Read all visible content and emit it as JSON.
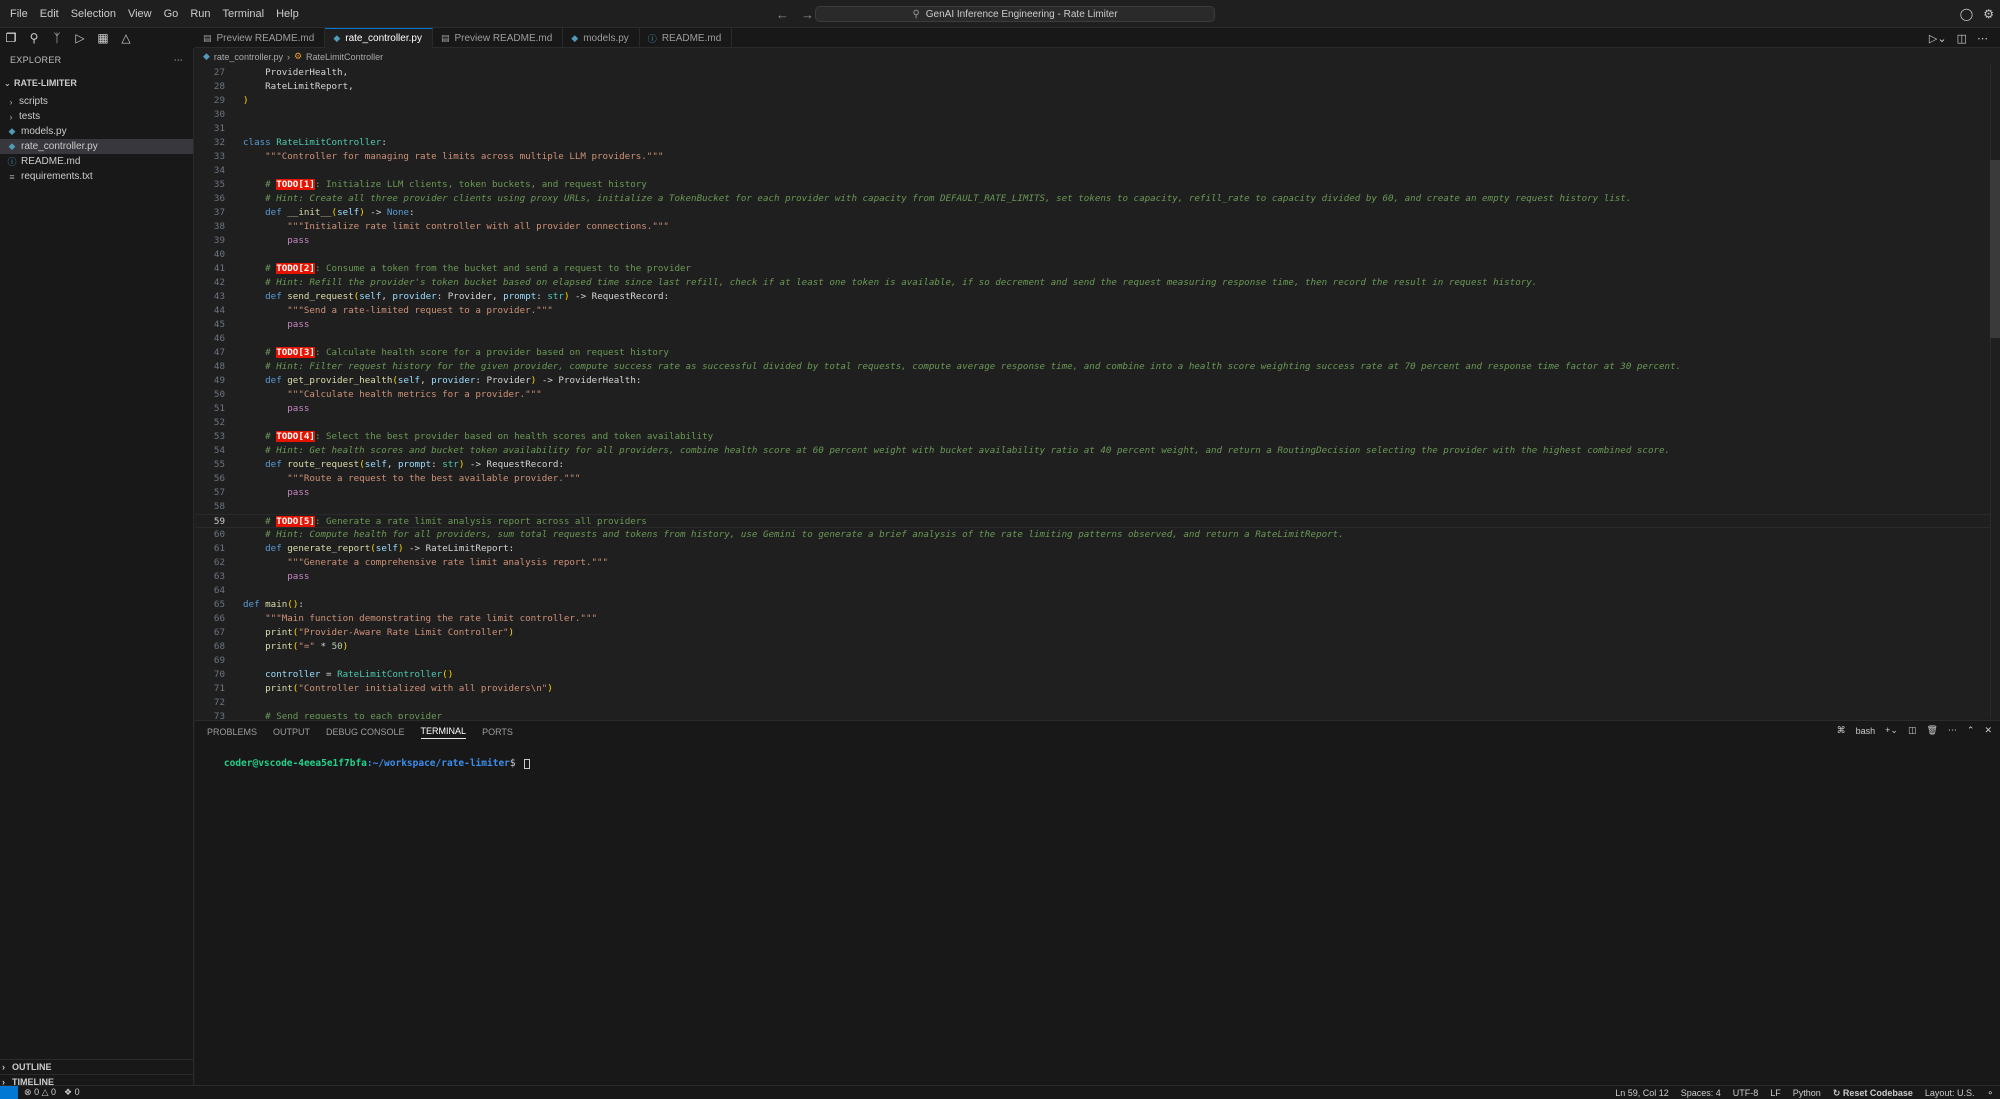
{
  "menu": [
    "File",
    "Edit",
    "Selection",
    "View",
    "Go",
    "Run",
    "Terminal",
    "Help"
  ],
  "command_center": "GenAI Inference Engineering - Rate Limiter",
  "tabs": [
    {
      "label": "Preview README.md",
      "icon": "preview-icon"
    },
    {
      "label": "rate_controller.py",
      "icon": "python-file-icon"
    },
    {
      "label": "Preview README.md",
      "icon": "preview-icon"
    },
    {
      "label": "models.py",
      "icon": "python-file-icon"
    },
    {
      "label": "README.md",
      "icon": "info-icon"
    }
  ],
  "explorer": {
    "title": "EXPLORER",
    "root": "RATE-LIMITER",
    "items": [
      {
        "label": "scripts",
        "type": "folder"
      },
      {
        "label": "tests",
        "type": "folder"
      },
      {
        "label": "models.py",
        "type": "py"
      },
      {
        "label": "rate_controller.py",
        "type": "py"
      },
      {
        "label": "README.md",
        "type": "md"
      },
      {
        "label": "requirements.txt",
        "type": "txt"
      }
    ],
    "outline": "OUTLINE",
    "timeline": "TIMELINE"
  },
  "breadcrumb": {
    "file": "rate_controller.py",
    "symbol": "RateLimitController"
  },
  "code": [
    {
      "n": "27",
      "t": [
        [
          "pl",
          "    ProviderHealth,"
        ]
      ]
    },
    {
      "n": "28",
      "t": [
        [
          "pl",
          "    RateLimitReport,"
        ]
      ]
    },
    {
      "n": "29",
      "t": [
        [
          "br",
          ")"
        ]
      ]
    },
    {
      "n": "30",
      "t": []
    },
    {
      "n": "31",
      "t": []
    },
    {
      "n": "32",
      "t": [
        [
          "kw",
          "class "
        ],
        [
          "cls",
          "RateLimitController"
        ],
        [
          "pl",
          ":"
        ]
      ]
    },
    {
      "n": "33",
      "t": [
        [
          "str",
          "    \"\"\"Controller for managing rate limits across multiple LLM providers.\"\"\""
        ]
      ]
    },
    {
      "n": "34",
      "t": []
    },
    {
      "n": "35",
      "t": [
        [
          "cm",
          "    # "
        ],
        [
          "todo",
          "TODO[1]"
        ],
        [
          "cm",
          ": Initialize LLM clients, token buckets, and request history"
        ]
      ]
    },
    {
      "n": "36",
      "t": [
        [
          "cmi",
          "    # Hint: Create all three provider clients using proxy URLs, initialize a TokenBucket for each provider with capacity from DEFAULT_RATE_LIMITS, set tokens to capacity, refill_rate to capacity divided by 60, and create an empty request history list."
        ]
      ]
    },
    {
      "n": "37",
      "t": [
        [
          "kw",
          "    def "
        ],
        [
          "fn",
          "__init__"
        ],
        [
          "br",
          "("
        ],
        [
          "pm",
          "self"
        ],
        [
          "br",
          ")"
        ],
        [
          "op",
          " -> "
        ],
        [
          "kw",
          "None"
        ],
        [
          "pl",
          ":"
        ]
      ]
    },
    {
      "n": "38",
      "t": [
        [
          "str",
          "        \"\"\"Initialize rate limit controller with all provider connections.\"\"\""
        ]
      ]
    },
    {
      "n": "39",
      "t": [
        [
          "kw2",
          "        pass"
        ]
      ]
    },
    {
      "n": "40",
      "t": []
    },
    {
      "n": "41",
      "t": [
        [
          "cm",
          "    # "
        ],
        [
          "todo",
          "TODO[2]"
        ],
        [
          "cm",
          ": Consume a token from the bucket and send a request to the provider"
        ]
      ]
    },
    {
      "n": "42",
      "t": [
        [
          "cmi",
          "    # Hint: Refill the provider's token bucket based on elapsed time since last refill, check if at least one token is available, if so decrement and send the request measuring response time, then record the result in request history."
        ]
      ]
    },
    {
      "n": "43",
      "t": [
        [
          "kw",
          "    def "
        ],
        [
          "fn",
          "send_request"
        ],
        [
          "br",
          "("
        ],
        [
          "pm",
          "self"
        ],
        [
          "pl",
          ", "
        ],
        [
          "pm",
          "provider"
        ],
        [
          "pl",
          ": Provider, "
        ],
        [
          "pm",
          "prompt"
        ],
        [
          "pl",
          ": "
        ],
        [
          "cls",
          "str"
        ],
        [
          "br",
          ")"
        ],
        [
          "op",
          " -> "
        ],
        [
          "pl",
          "RequestRecord:"
        ]
      ]
    },
    {
      "n": "44",
      "t": [
        [
          "str",
          "        \"\"\"Send a rate-limited request to a provider.\"\"\""
        ]
      ]
    },
    {
      "n": "45",
      "t": [
        [
          "kw2",
          "        pass"
        ]
      ]
    },
    {
      "n": "46",
      "t": []
    },
    {
      "n": "47",
      "t": [
        [
          "cm",
          "    # "
        ],
        [
          "todo",
          "TODO[3]"
        ],
        [
          "cm",
          ": Calculate health score for a provider based on request history"
        ]
      ]
    },
    {
      "n": "48",
      "t": [
        [
          "cmi",
          "    # Hint: Filter request history for the given provider, compute success rate as successful divided by total requests, compute average response time, and combine into a health score weighting success rate at 70 percent and response time factor at 30 percent."
        ]
      ]
    },
    {
      "n": "49",
      "t": [
        [
          "kw",
          "    def "
        ],
        [
          "fn",
          "get_provider_health"
        ],
        [
          "br",
          "("
        ],
        [
          "pm",
          "self"
        ],
        [
          "pl",
          ", "
        ],
        [
          "pm",
          "provider"
        ],
        [
          "pl",
          ": Provider"
        ],
        [
          "br",
          ")"
        ],
        [
          "op",
          " -> "
        ],
        [
          "pl",
          "ProviderHealth:"
        ]
      ]
    },
    {
      "n": "50",
      "t": [
        [
          "str",
          "        \"\"\"Calculate health metrics for a provider.\"\"\""
        ]
      ]
    },
    {
      "n": "51",
      "t": [
        [
          "kw2",
          "        pass"
        ]
      ]
    },
    {
      "n": "52",
      "t": []
    },
    {
      "n": "53",
      "t": [
        [
          "cm",
          "    # "
        ],
        [
          "todo",
          "TODO[4]"
        ],
        [
          "cm",
          ": Select the best provider based on health scores and token availability"
        ]
      ]
    },
    {
      "n": "54",
      "t": [
        [
          "cmi",
          "    # Hint: Get health scores and bucket token availability for all providers, combine health score at 60 percent weight with bucket availability ratio at 40 percent weight, and return a RoutingDecision selecting the provider with the highest combined score."
        ]
      ]
    },
    {
      "n": "55",
      "t": [
        [
          "kw",
          "    def "
        ],
        [
          "fn",
          "route_request"
        ],
        [
          "br",
          "("
        ],
        [
          "pm",
          "self"
        ],
        [
          "pl",
          ", "
        ],
        [
          "pm",
          "prompt"
        ],
        [
          "pl",
          ": "
        ],
        [
          "cls",
          "str"
        ],
        [
          "br",
          ")"
        ],
        [
          "op",
          " -> "
        ],
        [
          "pl",
          "RequestRecord:"
        ]
      ]
    },
    {
      "n": "56",
      "t": [
        [
          "str",
          "        \"\"\"Route a request to the best available provider.\"\"\""
        ]
      ]
    },
    {
      "n": "57",
      "t": [
        [
          "kw2",
          "        pass"
        ]
      ]
    },
    {
      "n": "58",
      "t": []
    },
    {
      "n": "59",
      "t": [
        [
          "cm",
          "    # "
        ],
        [
          "todo",
          "TODO[5]"
        ],
        [
          "cm",
          ": Generate a rate limit analysis report across all providers"
        ]
      ],
      "current": true
    },
    {
      "n": "60",
      "t": [
        [
          "cmi",
          "    # Hint: Compute health for all providers, sum total requests and tokens from history, use Gemini to generate a brief analysis of the rate limiting patterns observed, and return a RateLimitReport."
        ]
      ]
    },
    {
      "n": "61",
      "t": [
        [
          "kw",
          "    def "
        ],
        [
          "fn",
          "generate_report"
        ],
        [
          "br",
          "("
        ],
        [
          "pm",
          "self"
        ],
        [
          "br",
          ")"
        ],
        [
          "op",
          " -> "
        ],
        [
          "pl",
          "RateLimitReport:"
        ]
      ]
    },
    {
      "n": "62",
      "t": [
        [
          "str",
          "        \"\"\"Generate a comprehensive rate limit analysis report.\"\"\""
        ]
      ]
    },
    {
      "n": "63",
      "t": [
        [
          "kw2",
          "        pass"
        ]
      ]
    },
    {
      "n": "64",
      "t": []
    },
    {
      "n": "65",
      "t": [
        [
          "kw",
          "def "
        ],
        [
          "fn",
          "main"
        ],
        [
          "br",
          "()"
        ],
        [
          "pl",
          ":"
        ]
      ]
    },
    {
      "n": "66",
      "t": [
        [
          "str",
          "    \"\"\"Main function demonstrating the rate limit controller.\"\"\""
        ]
      ]
    },
    {
      "n": "67",
      "t": [
        [
          "fn",
          "    print"
        ],
        [
          "br",
          "("
        ],
        [
          "str",
          "\"Provider-Aware Rate Limit Controller\""
        ],
        [
          "br",
          ")"
        ]
      ]
    },
    {
      "n": "68",
      "t": [
        [
          "fn",
          "    print"
        ],
        [
          "br",
          "("
        ],
        [
          "str",
          "\"=\""
        ],
        [
          "op",
          " * "
        ],
        [
          "num",
          "50"
        ],
        [
          "br",
          ")"
        ]
      ]
    },
    {
      "n": "69",
      "t": []
    },
    {
      "n": "70",
      "t": [
        [
          "pm",
          "    controller"
        ],
        [
          "op",
          " = "
        ],
        [
          "cls",
          "RateLimitController"
        ],
        [
          "br",
          "()"
        ]
      ]
    },
    {
      "n": "71",
      "t": [
        [
          "fn",
          "    print"
        ],
        [
          "br",
          "("
        ],
        [
          "str",
          "\"Controller initialized with all providers\\n\""
        ],
        [
          "br",
          ")"
        ]
      ]
    },
    {
      "n": "72",
      "t": []
    },
    {
      "n": "73",
      "t": [
        [
          "cm",
          "    # Send requests to each provider"
        ]
      ]
    }
  ],
  "panel": {
    "tabs": [
      "PROBLEMS",
      "OUTPUT",
      "DEBUG CONSOLE",
      "TERMINAL",
      "PORTS"
    ],
    "active_tab": "TERMINAL",
    "shell": "bash",
    "prompt_user": "coder@vscode-4eea5e1f7bfa",
    "prompt_path": ":~/workspace/rate-limiter",
    "prompt_end": "$ "
  },
  "status": {
    "errors": "0",
    "warnings": "0",
    "ports": "0",
    "position": "Ln 59, Col 12",
    "spaces": "Spaces: 4",
    "encoding": "UTF-8",
    "eol": "LF",
    "language": "Python",
    "reset": "Reset Codebase",
    "layout": "Layout: U.S."
  },
  "colors": {
    "accent": "#0078d4",
    "todo_bg": "#e51400"
  }
}
